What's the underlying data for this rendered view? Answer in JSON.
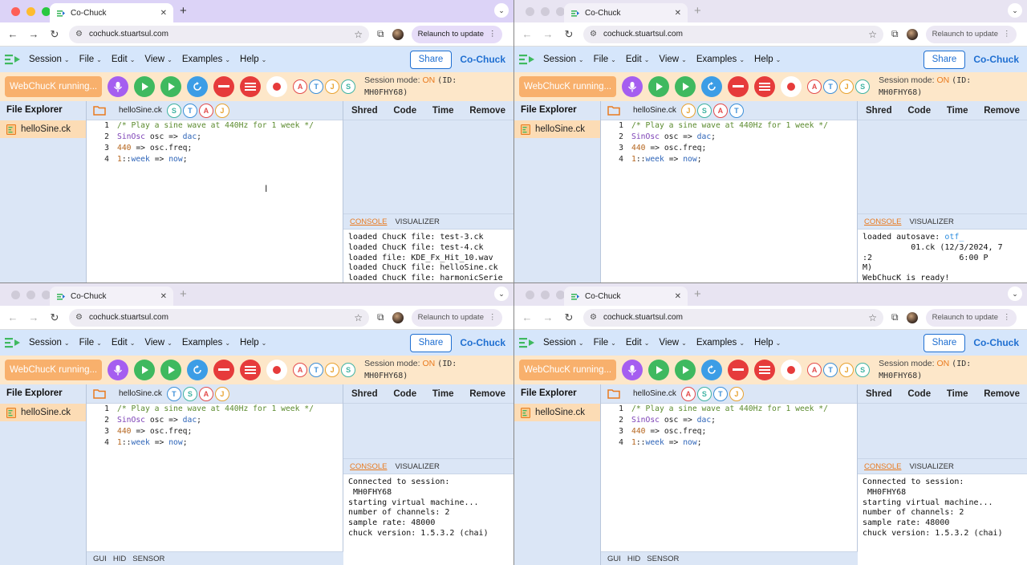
{
  "windows": [
    {
      "tab_title": "Co-Chuck",
      "url": "cochuck.stuartsul.com",
      "relaunch_label": "Relaunch to update",
      "menus": [
        "Session",
        "File",
        "Edit",
        "View",
        "Examples",
        "Help"
      ],
      "share_label": "Share",
      "brand": "Co-Chuck",
      "vm_label": "WebChucK running...",
      "presence": [
        "A",
        "T",
        "J",
        "S"
      ],
      "session_label": "Session mode:",
      "session_on": "ON",
      "session_id_open": "(ID:",
      "session_id": "MH0FHY68)",
      "file_explorer_title": "File Explorer",
      "file_name": "helloSine.ck",
      "editor_filename": "helloSine.ck",
      "editor_presence": [
        "S",
        "T",
        "A",
        "J"
      ],
      "shred_headers": [
        "Shred",
        "Code",
        "Time",
        "Remove"
      ],
      "console_tab": "CONSOLE",
      "visualizer_tab": "VISUALIZER",
      "console_lines": [
        "loaded ChucK file: test-3.ck",
        "loaded ChucK file: test-4.ck",
        "loaded file: KDE_Fx_Hit_10.wav",
        "loaded ChucK file: helloSine.ck",
        "loaded ChucK file: harmonicSerie"
      ],
      "bottom_tabs": []
    },
    {
      "tab_title": "Co-Chuck",
      "url": "cochuck.stuartsul.com",
      "relaunch_label": "Relaunch to update",
      "menus": [
        "Session",
        "File",
        "Edit",
        "View",
        "Examples",
        "Help"
      ],
      "share_label": "Share",
      "brand": "Co-Chuck",
      "vm_label": "WebChucK running...",
      "presence": [
        "A",
        "T",
        "J",
        "S"
      ],
      "session_label": "Session mode:",
      "session_on": "ON",
      "session_id_open": "(ID:",
      "session_id": "MH0FHY68)",
      "file_explorer_title": "File Explorer",
      "file_name": "helloSine.ck",
      "editor_filename": "helloSine.ck",
      "editor_presence": [
        "J",
        "S",
        "A",
        "T"
      ],
      "shred_headers": [
        "Shred",
        "Code",
        "Time",
        "Remove"
      ],
      "console_tab": "CONSOLE",
      "visualizer_tab": "VISUALIZER",
      "console_lines": [
        "loaded autosave: otf_",
        "          01.ck (12/3/2024, 7",
        ":2                  6:00 P",
        "M)",
        "WebChucK is ready!"
      ],
      "bottom_tabs": []
    },
    {
      "tab_title": "Co-Chuck",
      "url": "cochuck.stuartsul.com",
      "relaunch_label": "Relaunch to update",
      "menus": [
        "Session",
        "File",
        "Edit",
        "View",
        "Examples",
        "Help"
      ],
      "share_label": "Share",
      "brand": "Co-Chuck",
      "vm_label": "WebChucK running...",
      "presence": [
        "A",
        "T",
        "J",
        "S"
      ],
      "session_label": "Session mode:",
      "session_on": "ON",
      "session_id_open": "(ID:",
      "session_id": "MH0FHY68)",
      "file_explorer_title": "File Explorer",
      "file_name": "helloSine.ck",
      "editor_filename": "helloSine.ck",
      "editor_presence": [
        "T",
        "S",
        "A",
        "J"
      ],
      "shred_headers": [
        "Shred",
        "Code",
        "Time",
        "Remove"
      ],
      "console_tab": "CONSOLE",
      "visualizer_tab": "VISUALIZER",
      "console_lines": [
        "Connected to session:",
        " MH0FHY68",
        "starting virtual machine...",
        "number of channels: 2",
        "sample rate: 48000",
        "chuck version: 1.5.3.2 (chai)"
      ],
      "bottom_tabs": [
        "GUI",
        "HID",
        "SENSOR"
      ]
    },
    {
      "tab_title": "Co-Chuck",
      "url": "cochuck.stuartsul.com",
      "relaunch_label": "Relaunch to update",
      "menus": [
        "Session",
        "File",
        "Edit",
        "View",
        "Examples",
        "Help"
      ],
      "share_label": "Share",
      "brand": "Co-Chuck",
      "vm_label": "WebChucK running...",
      "presence": [
        "A",
        "T",
        "J",
        "S"
      ],
      "session_label": "Session mode:",
      "session_on": "ON",
      "session_id_open": "(ID:",
      "session_id": "MH0FHY68)",
      "file_explorer_title": "File Explorer",
      "file_name": "helloSine.ck",
      "editor_filename": "helloSine.ck",
      "editor_presence": [
        "A",
        "S",
        "T",
        "J"
      ],
      "shred_headers": [
        "Shred",
        "Code",
        "Time",
        "Remove"
      ],
      "console_tab": "CONSOLE",
      "visualizer_tab": "VISUALIZER",
      "console_lines": [
        "Connected to session:",
        " MH0FHY68",
        "starting virtual machine...",
        "number of channels: 2",
        "sample rate: 48000",
        "chuck version: 1.5.3.2 (chai)"
      ],
      "bottom_tabs": [
        "GUI",
        "HID",
        "SENSOR"
      ]
    }
  ],
  "code": {
    "line_numbers": [
      "1",
      "2",
      "3",
      "4"
    ],
    "l1_comment": "/* Play a sine wave at 440Hz for 1 week */",
    "l2_type": "SinOsc",
    "l2_rest": " osc => ",
    "l2_dac": "dac",
    "l2_end": ";",
    "l3_num": "440",
    "l3_rest": " => osc.freq;",
    "l4_num": "1",
    "l4_rest": "::",
    "l4_week": "week",
    "l4_mid": " => ",
    "l4_now": "now",
    "l4_end": ";"
  },
  "icons": {
    "back": "back-arrow-icon",
    "forward": "forward-arrow-icon",
    "reload": "reload-icon",
    "mic": "microphone-icon",
    "add_shred": "add-shred-play-icon",
    "replace_shred": "replace-shred-icon",
    "remove_shred": "remove-shred-icon",
    "remove_all": "remove-all-icon",
    "record": "record-icon"
  },
  "colors": {
    "menubar": "#d6e6fb",
    "toolbar": "#fde7c9",
    "accent": "#1f6fd1",
    "session_on": "#e97a1e",
    "vm_button": "#f8b06c"
  }
}
